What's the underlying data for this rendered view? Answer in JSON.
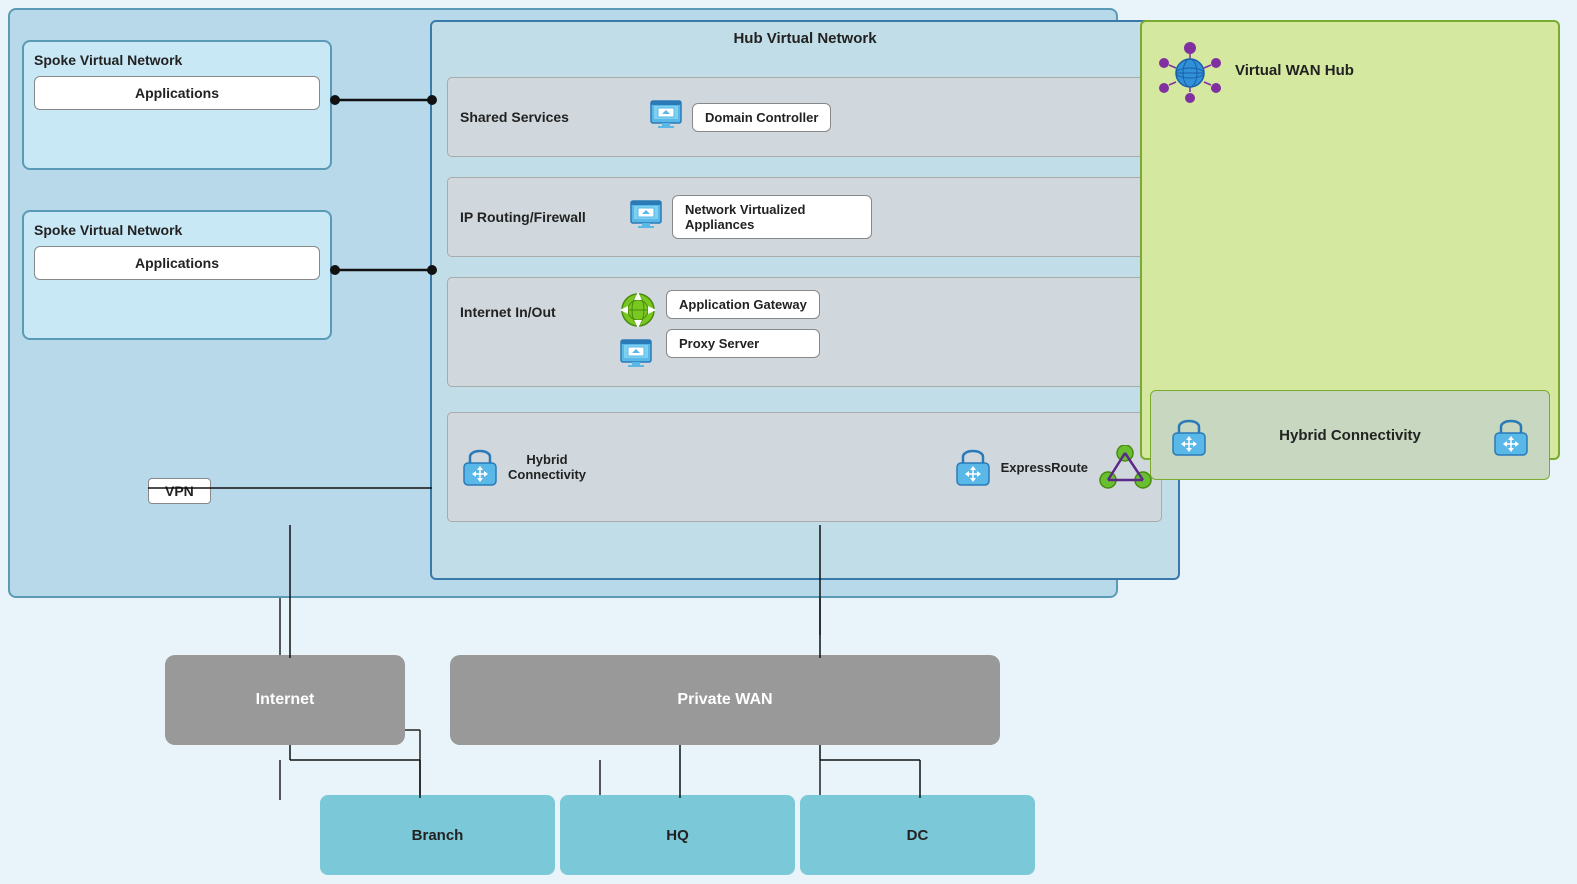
{
  "main_bg": {
    "color": "#b8d9ea"
  },
  "spoke1": {
    "title": "Spoke Virtual Network",
    "app_label": "Applications"
  },
  "spoke2": {
    "title": "Spoke Virtual Network",
    "app_label": "Applications"
  },
  "hub": {
    "title": "Hub Virtual Network",
    "services": [
      {
        "id": "shared-services",
        "label": "Shared Services",
        "component": "Domain Controller"
      },
      {
        "id": "ip-routing",
        "label": "IP Routing/Firewall",
        "component": "Network Virtualized Appliances"
      },
      {
        "id": "internet-inout",
        "label": "Internet In/Out",
        "components": [
          "Application Gateway",
          "Proxy Server"
        ]
      },
      {
        "id": "hybrid-conn",
        "label": "Hybrid Connectivity",
        "sub_label": "ExpressRoute"
      }
    ]
  },
  "vpn": {
    "label": "VPN"
  },
  "wan_hub": {
    "title": "Virtual WAN Hub",
    "hybrid_label": "Hybrid Connectivity"
  },
  "bottom": {
    "internet_label": "Internet",
    "private_wan_label": "Private WAN",
    "branch_label": "Branch",
    "hq_label": "HQ",
    "dc_label": "DC"
  },
  "icons": {
    "monitor": "🖥",
    "lock": "🔒",
    "globe_network": "🌐",
    "routing": "⬆"
  }
}
